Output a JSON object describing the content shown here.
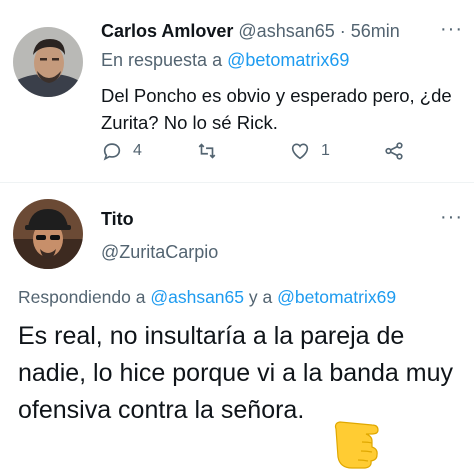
{
  "tweet1": {
    "author_name": "Carlos Amlover",
    "author_handle": "@ashsan65",
    "separator": "·",
    "time": "56min",
    "reply_prefix": "En respuesta a",
    "reply_to": "@betomatrix69",
    "text": "Del Poncho es obvio y esperado pero, ¿de Zurita? No lo sé Rick.",
    "replies_count": "4",
    "likes_count": "1",
    "icons": [
      "reply-icon",
      "retweet-icon",
      "like-icon",
      "share-icon",
      "more-icon"
    ]
  },
  "tweet2": {
    "author_name": "Tito",
    "author_handle": "@ZuritaCarpio",
    "reply_prefix": "Respondiendo a",
    "reply_to_1": "@ashsan65",
    "reply_joiner": "y a",
    "reply_to_2": "@betomatrix69",
    "text": "Es real, no insultaría a la pareja de nadie, lo hice porque vi a la banda muy ofensiva contra la señora.",
    "emoji": "pointing-hand-emoji"
  },
  "colors": {
    "text": "#0f1419",
    "muted": "#536471",
    "link": "#1d9bf0",
    "divider": "#eff3f4"
  }
}
